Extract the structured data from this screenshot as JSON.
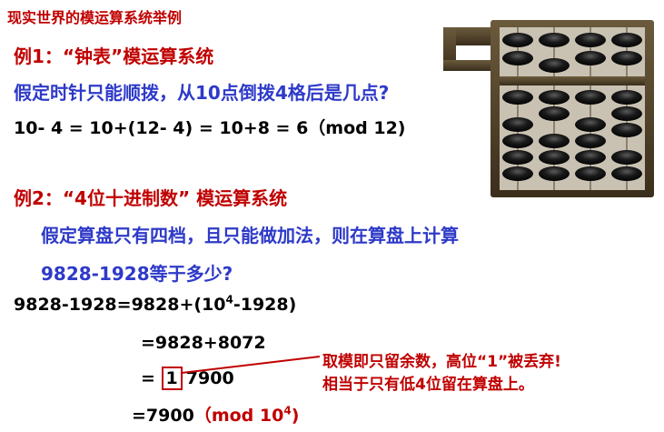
{
  "header": {
    "title": "现实世界的模运算系统举例"
  },
  "example1": {
    "title": "例1：“钟表”模运算系统",
    "question": "假定时针只能顺拨，从10点倒拨4格后是几点?",
    "equation": "10- 4 = 10+(12- 4) = 10+8 = 6（mod 12)"
  },
  "example2": {
    "title": "例2：“4位十进制数” 模运算系统",
    "question_line1": "假定算盘只有四档，且只能做加法，则在算盘上计算",
    "question_line2": "9828-1928等于多少?",
    "eq1_prefix": "9828-1928=9828+(10",
    "eq1_sup": "4",
    "eq1_suffix": "-1928)",
    "eq2": "=9828+8072",
    "eq3_prefix": "=",
    "eq3_boxed": "1",
    "eq3_rest": "7900",
    "eq4_prefix": "=7900",
    "eq4_mod_prefix": "（mod 10",
    "eq4_mod_sup": "4",
    "eq4_mod_suffix": ")",
    "note_line1": "取模即只留余数，高位“1”被丢弃!",
    "note_line2": "相当于只有低4位留在算盘上。"
  },
  "colors": {
    "red": "#c00000",
    "blue": "#2e3ac8",
    "black": "#000000"
  },
  "icons": {
    "abacus": "abacus-icon"
  }
}
